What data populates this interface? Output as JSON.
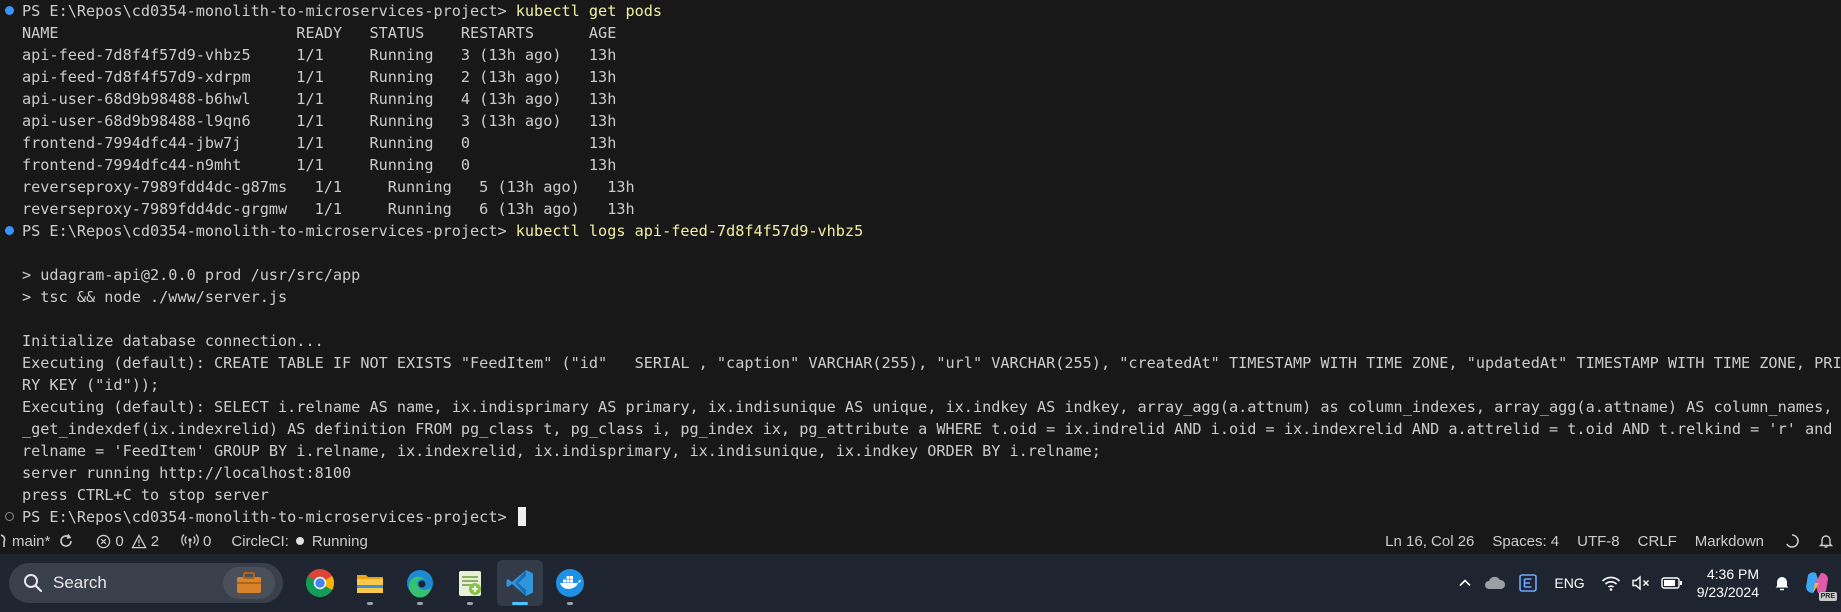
{
  "terminal": {
    "lines": [
      {
        "type": "prompt",
        "marker": "blue",
        "prefix": "PS E:\\Repos\\cd0354-monolith-to-microservices-project> ",
        "command": "kubectl get pods"
      },
      {
        "type": "text",
        "text": "NAME                          READY   STATUS    RESTARTS      AGE"
      },
      {
        "type": "text",
        "text": "api-feed-7d8f4f57d9-vhbz5     1/1     Running   3 (13h ago)   13h"
      },
      {
        "type": "text",
        "text": "api-feed-7d8f4f57d9-xdrpm     1/1     Running   2 (13h ago)   13h"
      },
      {
        "type": "text",
        "text": "api-user-68d9b98488-b6hwl     1/1     Running   4 (13h ago)   13h"
      },
      {
        "type": "text",
        "text": "api-user-68d9b98488-l9qn6     1/1     Running   3 (13h ago)   13h"
      },
      {
        "type": "text",
        "text": "frontend-7994dfc44-jbw7j      1/1     Running   0             13h"
      },
      {
        "type": "text",
        "text": "frontend-7994dfc44-n9mht      1/1     Running   0             13h"
      },
      {
        "type": "text",
        "text": "reverseproxy-7989fdd4dc-g87ms   1/1     Running   5 (13h ago)   13h"
      },
      {
        "type": "text",
        "text": "reverseproxy-7989fdd4dc-grgmw   1/1     Running   6 (13h ago)   13h"
      },
      {
        "type": "prompt",
        "marker": "blue",
        "prefix": "PS E:\\Repos\\cd0354-monolith-to-microservices-project> ",
        "command": "kubectl logs api-feed-7d8f4f57d9-vhbz5"
      },
      {
        "type": "text",
        "text": ""
      },
      {
        "type": "text",
        "text": "> udagram-api@2.0.0 prod /usr/src/app"
      },
      {
        "type": "text",
        "text": "> tsc && node ./www/server.js"
      },
      {
        "type": "text",
        "text": ""
      },
      {
        "type": "text",
        "text": "Initialize database connection..."
      },
      {
        "type": "text",
        "text": "Executing (default): CREATE TABLE IF NOT EXISTS \"FeedItem\" (\"id\"   SERIAL , \"caption\" VARCHAR(255), \"url\" VARCHAR(255), \"createdAt\" TIMESTAMP WITH TIME ZONE, \"updatedAt\" TIMESTAMP WITH TIME ZONE, PRIMA"
      },
      {
        "type": "text",
        "text": "RY KEY (\"id\"));"
      },
      {
        "type": "text",
        "text": "Executing (default): SELECT i.relname AS name, ix.indisprimary AS primary, ix.indisunique AS unique, ix.indkey AS indkey, array_agg(a.attnum) as column_indexes, array_agg(a.attname) AS column_names, pg"
      },
      {
        "type": "text",
        "text": "_get_indexdef(ix.indexrelid) AS definition FROM pg_class t, pg_class i, pg_index ix, pg_attribute a WHERE t.oid = ix.indrelid AND i.oid = ix.indexrelid AND a.attrelid = t.oid AND t.relkind = 'r' and t."
      },
      {
        "type": "text",
        "text": "relname = 'FeedItem' GROUP BY i.relname, ix.indexrelid, ix.indisprimary, ix.indisunique, ix.indkey ORDER BY i.relname;"
      },
      {
        "type": "text",
        "text": "server running http://localhost:8100"
      },
      {
        "type": "text",
        "text": "press CTRL+C to stop server"
      },
      {
        "type": "prompt",
        "marker": "hollow",
        "prefix": "PS E:\\Repos\\cd0354-monolith-to-microservices-project> ",
        "command": "",
        "cursor": true
      }
    ]
  },
  "statusbar": {
    "branch": "main*",
    "errors": "0",
    "warnings": "2",
    "ports": "0",
    "circleci_label": "CircleCI:",
    "circleci_status": "Running",
    "cursor_position": "Ln 16, Col 26",
    "indentation": "Spaces: 4",
    "encoding": "UTF-8",
    "line_ending": "CRLF",
    "language": "Markdown"
  },
  "taskbar": {
    "search_label": "Search",
    "apps": [
      {
        "name": "chrome",
        "icon": "chrome-icon",
        "active": false
      },
      {
        "name": "file-explorer",
        "icon": "folder-icon",
        "active": false
      },
      {
        "name": "edge",
        "icon": "edge-icon",
        "active": false
      },
      {
        "name": "notepad-plus-plus",
        "icon": "notepad-plus-plus-icon",
        "active": false
      },
      {
        "name": "vscode",
        "icon": "vscode-icon",
        "active": true
      },
      {
        "name": "docker",
        "icon": "docker-icon",
        "active": false
      }
    ],
    "language": "ENG",
    "time": "4:36 PM",
    "date": "9/23/2024",
    "copilot_badge": "PRE"
  },
  "colors": {
    "terminal_bg": "#181818",
    "terminal_text": "#cccccc",
    "command": "#f1f1a0",
    "prompt_marker": "#3794ff",
    "taskbar_bg": "#1f2530",
    "active_indicator": "#4cc2ff"
  }
}
